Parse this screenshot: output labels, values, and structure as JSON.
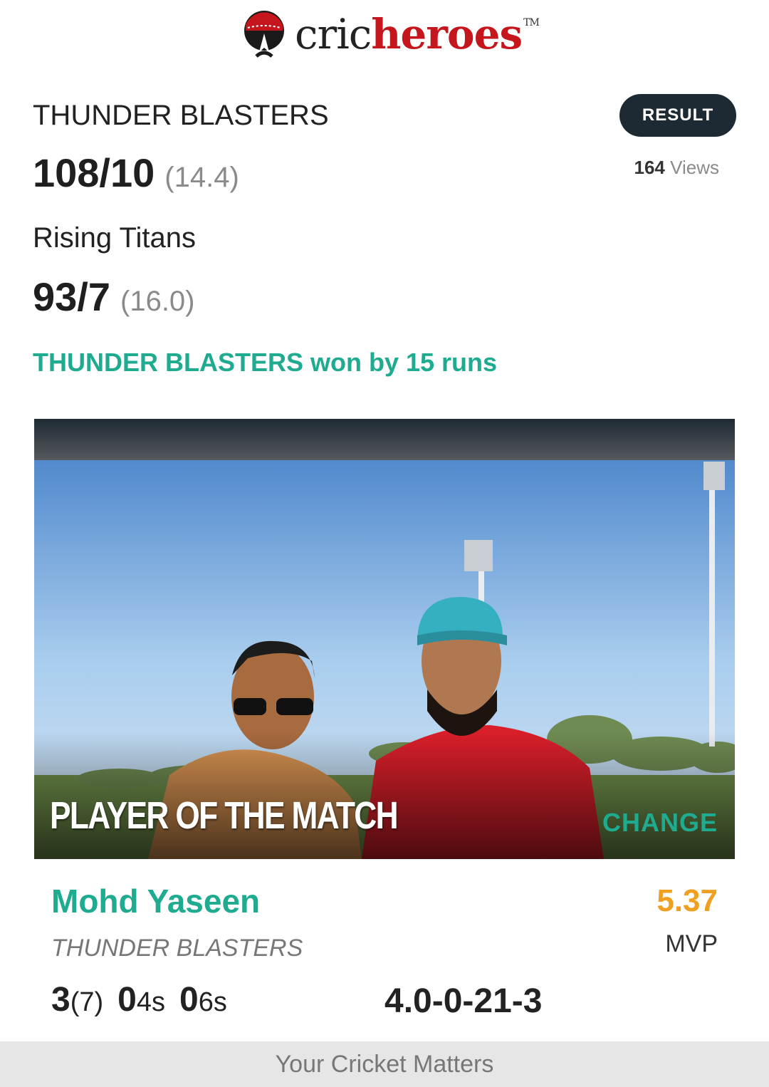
{
  "brand": {
    "name_part1": "cric",
    "name_part2": "heroes",
    "trademark": "TM"
  },
  "match": {
    "team1": {
      "name": "THUNDER BLASTERS",
      "score": "108/10",
      "overs": "(14.4)"
    },
    "team2": {
      "name": "Rising Titans",
      "score": "93/7",
      "overs": "(16.0)"
    },
    "status_button": "RESULT",
    "views_count": "164",
    "views_label": "Views",
    "result_text": "THUNDER BLASTERS won by 15 runs"
  },
  "player_of_match": {
    "banner_label": "PLAYER OF THE MATCH",
    "change_label": "CHANGE",
    "name": "Mohd Yaseen",
    "team": "THUNDER BLASTERS",
    "mvp_value": "5.37",
    "mvp_label": "MVP",
    "runs": "3",
    "balls": "(7)",
    "fours": "0",
    "fours_suffix": "4s",
    "sixes": "0",
    "sixes_suffix": "6s",
    "bowling": "4.0-0-21-3"
  },
  "footer": {
    "tagline": "Your Cricket Matters"
  },
  "colors": {
    "accent_green": "#1eab8f",
    "brand_red": "#c4161c",
    "mvp_orange": "#f0a020",
    "button_dark": "#1e2a33"
  }
}
